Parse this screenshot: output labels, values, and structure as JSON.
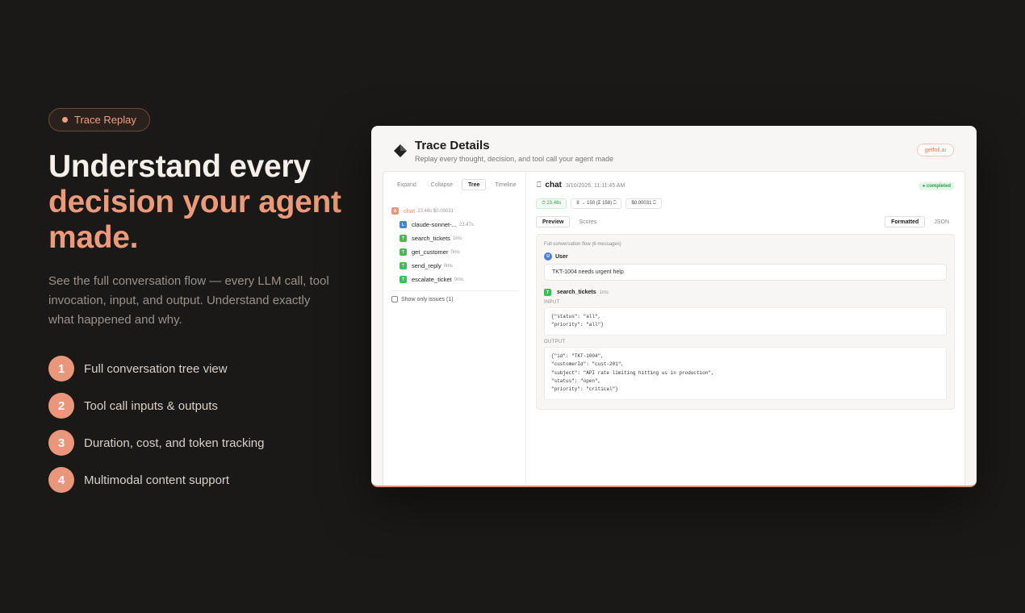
{
  "hero": {
    "badge": "Trace Replay",
    "headline_line1": "Understand every",
    "headline_line2": "decision your agent made.",
    "description": "See the full conversation flow — every LLM call, tool invocation, input, and output. Understand exactly what happened and why.",
    "features": [
      {
        "num": "1",
        "text": "Full conversation tree view"
      },
      {
        "num": "2",
        "text": "Tool call inputs & outputs"
      },
      {
        "num": "3",
        "text": "Duration, cost, and token tracking"
      },
      {
        "num": "4",
        "text": "Multimodal content support"
      }
    ]
  },
  "card": {
    "title": "Trace Details",
    "subtitle": "Replay every thought, decision, and tool call your agent made",
    "site": "getfoil.ai"
  },
  "tree": {
    "tabs": [
      "Expand",
      "Collapse",
      "Tree",
      "Timeline"
    ],
    "active_tab": "Tree",
    "nodes": [
      {
        "icon": "A",
        "name": "chat",
        "meta": "23.48s $0.00031"
      },
      {
        "icon": "L",
        "name": "claude-sonnet-...",
        "meta": "23.47s"
      },
      {
        "icon": "T",
        "name": "search_tickets",
        "meta": "1ms"
      },
      {
        "icon": "T",
        "name": "get_customer",
        "meta": "0ms"
      },
      {
        "icon": "T",
        "name": "send_reply",
        "meta": "0ms"
      },
      {
        "icon": "T",
        "name": "escalate_ticket",
        "meta": "0ms"
      }
    ],
    "issues_label": "Show only issues (1)"
  },
  "detail": {
    "chat_icon": "⎕",
    "name": "chat",
    "timestamp": "3/10/2026, 11:11:45 AM",
    "status": "● completed",
    "metrics": [
      "⏱ 23.48s",
      "8 → 150 (Σ 158) ⎕",
      "$0.00031 ⎕"
    ],
    "view_tabs": [
      "Preview",
      "Scores"
    ],
    "format_tabs": [
      "Formatted",
      "JSON"
    ],
    "flow_label": "Full conversation flow (6 messages)",
    "user_icon": "U",
    "user_role": "User",
    "user_message": "TKT-1004 needs urgent help",
    "tool_icon": "T",
    "tool_name": "search_tickets",
    "tool_duration": "1ms",
    "input_label": "INPUT",
    "input_code": "{\"status\": \"all\",\n\"priority\": \"all\"}",
    "output_label": "OUTPUT",
    "output_code": "{\"id\": \"TKT-1004\",\n\"customerId\": \"cust-201\",\n\"subject\": \"API rate limiting hitting us in production\",\n\"status\": \"open\",\n\"priority\": \"critical\"}"
  },
  "colors": {
    "accent": "#ec9a78",
    "background": "#1b1918",
    "success": "#3bbf57",
    "llm": "#4a7fe0"
  }
}
